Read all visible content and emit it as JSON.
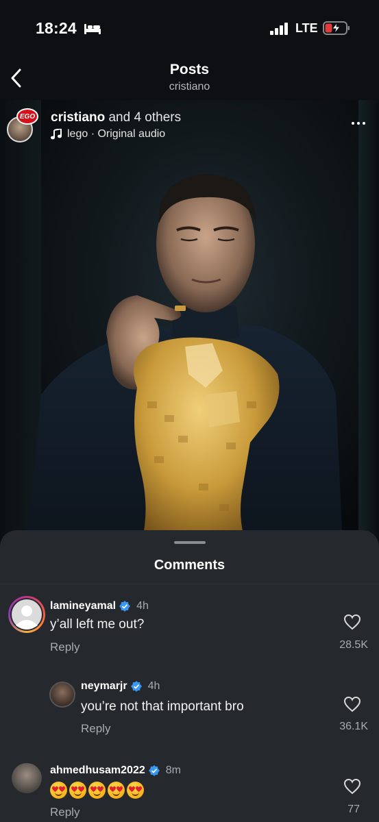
{
  "status_bar": {
    "time": "18:24",
    "network": "LTE"
  },
  "header": {
    "title": "Posts",
    "subtitle": "cristiano"
  },
  "post": {
    "author": "cristiano",
    "collab_text": "and 4 others",
    "audio": "lego · Original audio",
    "badge_text": "EGO"
  },
  "comments_sheet": {
    "title": "Comments",
    "comments": [
      {
        "username": "lamineyamal",
        "verified": true,
        "time": "4h",
        "text": "y’all left me out?",
        "reply_label": "Reply",
        "likes": "28.5K"
      },
      {
        "username": "neymarjr",
        "verified": true,
        "time": "4h",
        "text": "you’re not that important bro",
        "reply_label": "Reply",
        "likes": "36.1K"
      },
      {
        "username": "ahmedhusam2022",
        "verified": true,
        "time": "8m",
        "text": "",
        "emoji_count": 5,
        "emoji_name": "heart-eyes-emoji",
        "reply_label": "Reply",
        "likes": "77"
      }
    ]
  },
  "colors": {
    "verified_blue": "#3897f0",
    "sheet_bg": "#25282d",
    "muted_text": "#a8acb2"
  }
}
